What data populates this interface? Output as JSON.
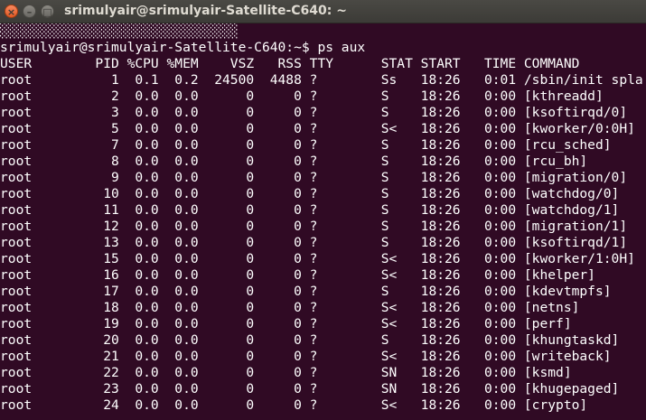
{
  "window": {
    "title": "srimulyair@srimulyair-Satellite-C640: ~",
    "close_glyph": "×",
    "minimize_glyph": "–",
    "maximize_glyph": "□"
  },
  "terminal": {
    "background": "#300a24",
    "foreground": "#ffffff",
    "lines": [
      "░░░░░░░░░░░░░░░░░░░░░░░░░░░░░░",
      "srimulyair@srimulyair-Satellite-C640:~$ ps aux",
      "USER        PID %CPU %MEM    VSZ   RSS TTY      STAT START   TIME COMMAND",
      "root          1  0.1  0.2  24500  4488 ?        Ss   18:26   0:01 /sbin/init spla",
      "root          2  0.0  0.0      0     0 ?        S    18:26   0:00 [kthreadd]",
      "root          3  0.0  0.0      0     0 ?        S    18:26   0:00 [ksoftirqd/0]",
      "root          5  0.0  0.0      0     0 ?        S<   18:26   0:00 [kworker/0:0H]",
      "root          7  0.0  0.0      0     0 ?        S    18:26   0:00 [rcu_sched]",
      "root          8  0.0  0.0      0     0 ?        S    18:26   0:00 [rcu_bh]",
      "root          9  0.0  0.0      0     0 ?        S    18:26   0:00 [migration/0]",
      "root         10  0.0  0.0      0     0 ?        S    18:26   0:00 [watchdog/0]",
      "root         11  0.0  0.0      0     0 ?        S    18:26   0:00 [watchdog/1]",
      "root         12  0.0  0.0      0     0 ?        S    18:26   0:00 [migration/1]",
      "root         13  0.0  0.0      0     0 ?        S    18:26   0:00 [ksoftirqd/1]",
      "root         15  0.0  0.0      0     0 ?        S<   18:26   0:00 [kworker/1:0H]",
      "root         16  0.0  0.0      0     0 ?        S<   18:26   0:00 [khelper]",
      "root         17  0.0  0.0      0     0 ?        S    18:26   0:00 [kdevtmpfs]",
      "root         18  0.0  0.0      0     0 ?        S<   18:26   0:00 [netns]",
      "root         19  0.0  0.0      0     0 ?        S<   18:26   0:00 [perf]",
      "root         20  0.0  0.0      0     0 ?        S    18:26   0:00 [khungtaskd]",
      "root         21  0.0  0.0      0     0 ?        S<   18:26   0:00 [writeback]",
      "root         22  0.0  0.0      0     0 ?        SN   18:26   0:00 [ksmd]",
      "root         23  0.0  0.0      0     0 ?        SN   18:26   0:00 [khugepaged]",
      "root         24  0.0  0.0      0     0 ?        S<   18:26   0:00 [crypto]"
    ]
  }
}
